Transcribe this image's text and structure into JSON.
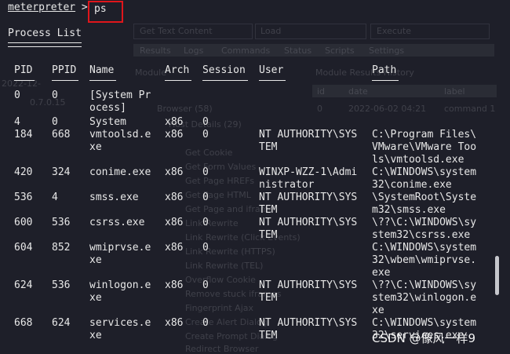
{
  "prompt": {
    "context": "meterpreter",
    "symbol": ">",
    "command": "ps"
  },
  "title": "Process List",
  "columns": [
    "PID",
    "PPID",
    "Name",
    "Arch",
    "Session",
    "User",
    "Path"
  ],
  "rows": [
    {
      "pid": "0",
      "ppid": "0",
      "name": "[System Pr\nocess]",
      "arch": "",
      "session": "",
      "user": "",
      "path": ""
    },
    {
      "pid": "4",
      "ppid": "0",
      "name": "System",
      "arch": "x86",
      "session": "0",
      "user": "",
      "path": ""
    },
    {
      "pid": "184",
      "ppid": "668",
      "name": "vmtoolsd.e\nxe",
      "arch": "x86",
      "session": "0",
      "user": "NT AUTHORITY\\SYS\nTEM",
      "path": "C:\\Program Files\\\nVMware\\VMware Too\nls\\vmtoolsd.exe"
    },
    {
      "pid": "420",
      "ppid": "324",
      "name": "conime.exe",
      "arch": "x86",
      "session": "0",
      "user": "WINXP-WZZ-1\\Admi\nnistrator",
      "path": "C:\\WINDOWS\\system\n32\\conime.exe"
    },
    {
      "pid": "536",
      "ppid": "4",
      "name": "smss.exe",
      "arch": "x86",
      "session": "0",
      "user": "NT AUTHORITY\\SYS\nTEM",
      "path": "\\SystemRoot\\Syste\nm32\\smss.exe"
    },
    {
      "pid": "600",
      "ppid": "536",
      "name": "csrss.exe",
      "arch": "x86",
      "session": "0",
      "user": "NT AUTHORITY\\SYS\nTEM",
      "path": "\\??\\C:\\WINDOWS\\sy\nstem32\\csrss.exe"
    },
    {
      "pid": "604",
      "ppid": "852",
      "name": "wmiprvse.e\nxe",
      "arch": "x86",
      "session": "0",
      "user": "",
      "path": "C:\\WINDOWS\\system\n32\\wbem\\wmiprvse.\nexe"
    },
    {
      "pid": "624",
      "ppid": "536",
      "name": "winlogon.e\nxe",
      "arch": "x86",
      "session": "0",
      "user": "NT AUTHORITY\\SYS\nTEM",
      "path": "\\??\\C:\\WINDOWS\\sy\nstem32\\winlogon.e\nxe"
    },
    {
      "pid": "668",
      "ppid": "624",
      "name": "services.e\nxe",
      "arch": "x86",
      "session": "0",
      "user": "NT AUTHORITY\\SYS\nTEM",
      "path": "C:\\WINDOWS\\system\n32\\services.exe"
    }
  ],
  "background_ghost": {
    "fields": [
      "Get Text Content",
      "Load",
      "Execute"
    ],
    "tabs": [
      "Results",
      "Logs",
      "Commands",
      "Status",
      "Scripts",
      "Settings"
    ],
    "left_items": [
      "Module",
      "Browser (58)",
      "Host Details (29)",
      "Get Cookie",
      "Get Form Values",
      "Get Page HREFs",
      "Get Page HTML",
      "Get Page and iframe",
      "Link Rewrite",
      "Link Rewrite (Click Events)",
      "Link Rewrite (HTTPS)",
      "Link Rewrite (TEL)",
      "Overflow Cookie",
      "Remove stuck iframes",
      "Fingerprint Ajax",
      "Create Alert Dialog",
      "Create Prompt Dialog",
      "Redirect Browser"
    ],
    "right_header": [
      "Module Results History"
    ],
    "right_cols": [
      "id",
      "date",
      "label"
    ],
    "right_row": [
      "0",
      "2022-06-02 04:21",
      "command 1"
    ],
    "left_num": [
      "2022-12-",
      "0.7.0.15"
    ]
  },
  "watermark": "CSDN @像风一样9",
  "colors": {
    "background": "#1e1f29",
    "text": "#e8e8e8",
    "highlight_box": "#e0161b"
  }
}
